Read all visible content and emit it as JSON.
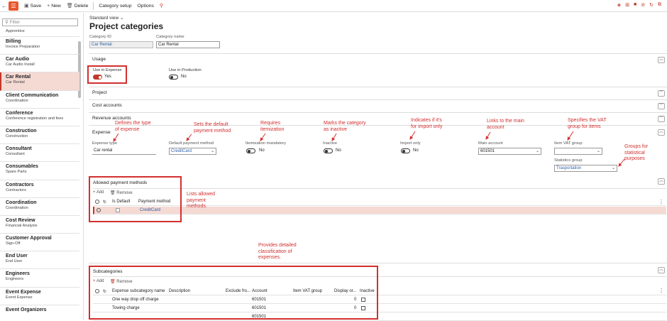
{
  "toolbar": {
    "save": "Save",
    "new": "New",
    "delete": "Delete",
    "category_setup": "Category setup",
    "options": "Options"
  },
  "sidebar": {
    "filter_placeholder": "Filter",
    "partial_top": {
      "title": "Apprentice"
    },
    "items": [
      {
        "title": "Billing",
        "sub": "Invoice Preparation"
      },
      {
        "title": "Car Audio",
        "sub": "Car Audio Install"
      },
      {
        "title": "Car Rental",
        "sub": "Car Rental"
      },
      {
        "title": "Client Communication",
        "sub": "Coordination"
      },
      {
        "title": "Conference",
        "sub": "Conference registration and fees"
      },
      {
        "title": "Construction",
        "sub": "Construction"
      },
      {
        "title": "Consultant",
        "sub": "Consultant"
      },
      {
        "title": "Consumables",
        "sub": "Spare Parts"
      },
      {
        "title": "Contractors",
        "sub": "Contractors"
      },
      {
        "title": "Coordination",
        "sub": "Coordination"
      },
      {
        "title": "Cost Review",
        "sub": "Financial Analysis"
      },
      {
        "title": "Customer Approval",
        "sub": "Sign-Off"
      },
      {
        "title": "End User",
        "sub": "End User"
      },
      {
        "title": "Engineers",
        "sub": "Engineers"
      },
      {
        "title": "Event Expense",
        "sub": "Event Expense"
      },
      {
        "title": "Event Organizers",
        "sub": ""
      }
    ]
  },
  "header": {
    "view": "Standard view",
    "title": "Project categories"
  },
  "fields": {
    "category_id_label": "Category ID",
    "category_id": "Car Rental",
    "category_name_label": "Category name",
    "category_name": "Car Rental"
  },
  "usage": {
    "title": "Usage",
    "use_in_expense_label": "Use in Expense",
    "use_in_expense": "Yes",
    "use_in_production_label": "Use in Production",
    "use_in_production": "No"
  },
  "sections": {
    "project": "Project",
    "cost_accounts": "Cost accounts",
    "revenue_accounts": "Revenue accounts",
    "expense": "Expense"
  },
  "expense": {
    "expense_type_label": "Expense type",
    "expense_type": "Car rental",
    "default_payment_label": "Default payment method",
    "default_payment": "CreditCard",
    "itemisation_label": "Itemisation mandatory",
    "itemisation": "No",
    "inactive_label": "Inactive",
    "inactive": "No",
    "import_only_label": "Import only",
    "import_only": "No",
    "main_account_label": "Main account",
    "main_account": "601501",
    "item_vat_label": "Item VAT group",
    "item_vat": "",
    "stats_group_label": "Statistics group",
    "stats_group": "Trasportation"
  },
  "allowed": {
    "title": "Allowed payment methods",
    "add": "Add",
    "remove": "Remove",
    "col_default": "Is Default",
    "col_method": "Payment method",
    "row_method": "CreditCard"
  },
  "subcategories": {
    "title": "Subcategories",
    "add": "Add",
    "remove": "Remove",
    "columns": [
      "Expense subcategory name",
      "Description",
      "Exclude fro...",
      "Account",
      "Item VAT group",
      "Display or...",
      "Inactive"
    ],
    "rows": [
      {
        "name": "One way drop off charge",
        "account": "601501",
        "display": "0"
      },
      {
        "name": "Towing charge",
        "account": "601501",
        "display": "0"
      },
      {
        "name": "",
        "account": "601501",
        "display": ""
      }
    ]
  },
  "annotations": {
    "a1": "Defines the type\nof expense",
    "a2": "Sets the default\npayment method",
    "a3": "Requires\nitemization",
    "a4": "Marks the category\nas inactive",
    "a5": "Indicates if it's\nfor import only",
    "a6": "Links to the main\naccount",
    "a7": "Specifies the VAT\ngroup for items",
    "a8": "Groups for\nstatistical\npurposes",
    "a9": "Lists allowed\npayment\nmethods.",
    "a10": "Provides detailed\nclassification of\nexpenses."
  },
  "colors": {
    "accent": "#c0392b",
    "annotation": "#d32f2f",
    "link": "#2e5fa8"
  }
}
